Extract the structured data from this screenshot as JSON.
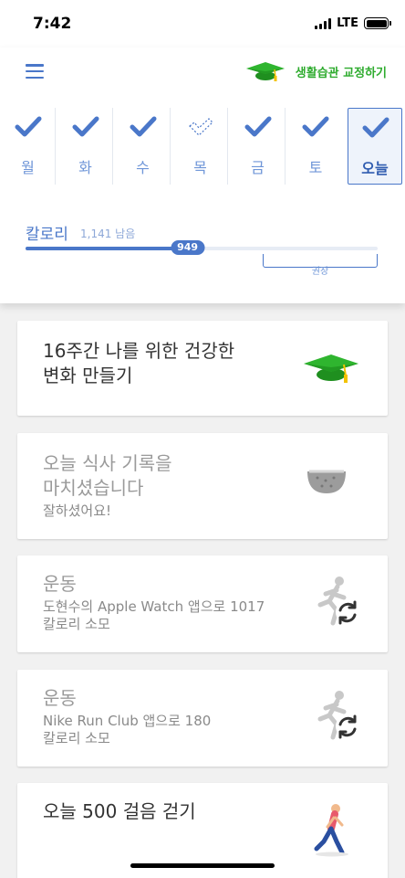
{
  "status_bar": {
    "time": "7:42",
    "network": "LTE"
  },
  "header": {
    "program_label": "생활습관 교정하기",
    "days": [
      {
        "label": "월",
        "state": "done"
      },
      {
        "label": "화",
        "state": "done"
      },
      {
        "label": "수",
        "state": "done"
      },
      {
        "label": "목",
        "state": "missed"
      },
      {
        "label": "금",
        "state": "done"
      },
      {
        "label": "토",
        "state": "done"
      },
      {
        "label": "오늘",
        "state": "done"
      }
    ],
    "calorie_title": "칼로리",
    "calorie_remaining": "1,141 남음",
    "calorie_value": "949",
    "calorie_progress_fraction": 0.46,
    "recommended_label": "권장"
  },
  "cards": [
    {
      "title": "16주간 나를 위한 건강한\n변화 만들기",
      "subtitle": "",
      "icon": "graduation-cap-icon"
    },
    {
      "title": "오늘 식사 기록을\n마치셨습니다",
      "subtitle": "잘하셨어요!",
      "icon": "bowl-icon"
    },
    {
      "title": "운동",
      "subtitle": "도현수의 Apple Watch 앱으로 1017\n칼로리 소모",
      "icon": "exercise-sync-icon"
    },
    {
      "title": "운동",
      "subtitle": "Nike Run Club 앱으로 180\n칼로리 소모",
      "icon": "exercise-sync-icon"
    },
    {
      "title": "오늘 500 걸음 걷기",
      "subtitle": "",
      "icon": "walking-person-icon"
    }
  ],
  "colors": {
    "accent": "#4a77c9",
    "program_green": "#2eab2e",
    "background": "#f1f1f1"
  }
}
